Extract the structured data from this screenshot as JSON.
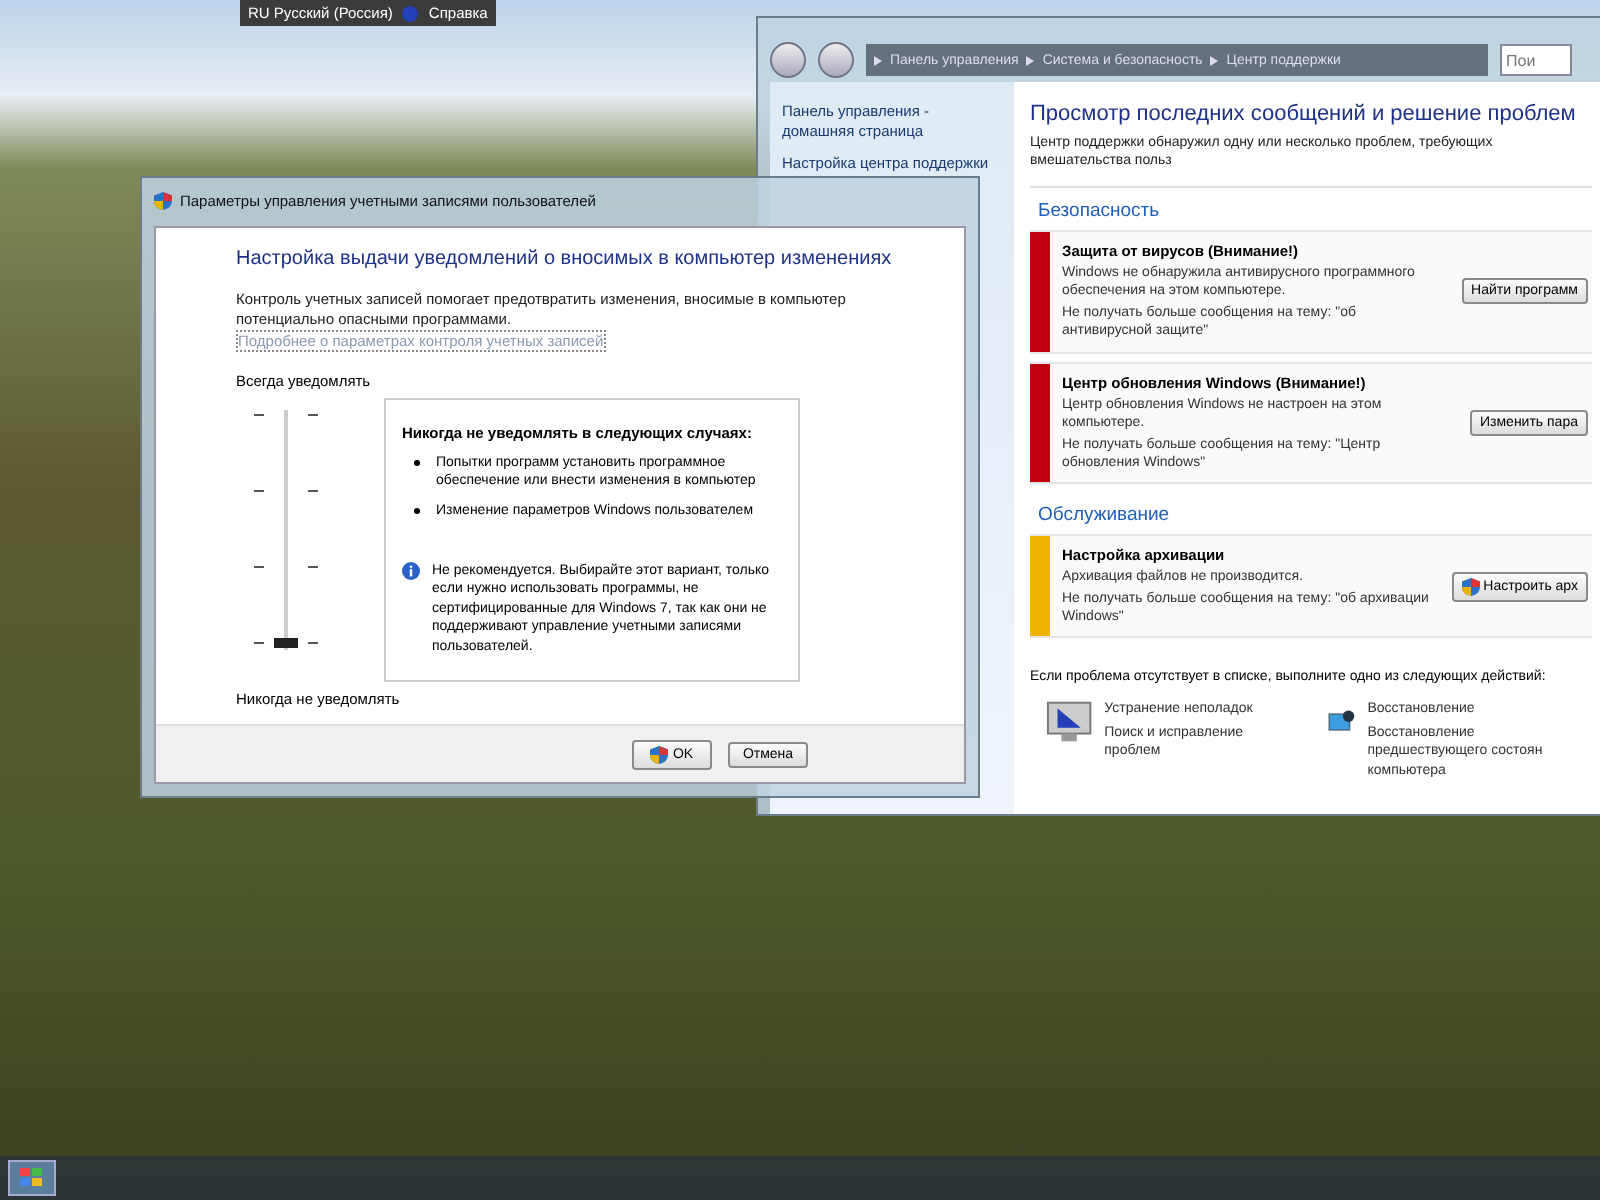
{
  "language_bar": {
    "language": "RU Русский (Россия)",
    "help": "Справка"
  },
  "control_panel": {
    "breadcrumb": [
      "Панель управления",
      "Система и безопасность",
      "Центр поддержки"
    ],
    "search": {
      "placeholder": "Пои"
    },
    "sidebar_links": [
      "Панель управления - домашняя страница",
      "Настройка центра поддержки"
    ],
    "title": "Просмотр последних сообщений и решение проблем",
    "subtitle": "Центр поддержки обнаружил одну или несколько проблем, требующих вмешательства польз",
    "sections": [
      {
        "heading": "Безопасность",
        "items": [
          {
            "title": "Защита от вирусов  (Внимание!)",
            "description": "Windows не обнаружила антивирусного программного обеспечения на этом компьютере.",
            "dismiss": "Не получать больше сообщения на тему: \"об антивирусной защите\"",
            "button": "Найти программ",
            "shield": false,
            "color": "#c00010"
          },
          {
            "title": "Центр обновления Windows  (Внимание!)",
            "description": "Центр обновления Windows не настроен на этом компьютере.",
            "dismiss": "Не получать больше сообщения на тему: \"Центр обновления Windows\"",
            "button": "Изменить пара",
            "shield": false,
            "color": "#c00010"
          }
        ]
      },
      {
        "heading": "Обслуживание",
        "items": [
          {
            "title": "Настройка архивации",
            "description": "Архивация файлов не производится.",
            "dismiss": "Не получать больше сообщения на тему: \"об архивации Windows\"",
            "button": "Настроить арх",
            "shield": true,
            "color": "#f0b400"
          }
        ]
      }
    ],
    "footer_prompt": "Если проблема отсутствует в списке, выполните одно из следующих действий:",
    "actions": [
      {
        "kind": "troubleshoot",
        "title": "Устранение неполадок",
        "description": "Поиск и исправление проблем"
      },
      {
        "kind": "recovery",
        "title": "Восстановление",
        "description": "Восстановление предшествующего состоян компьютера"
      }
    ]
  },
  "uac_dialog": {
    "title": "Параметры управления учетными записями пользователей",
    "heading": "Настройка выдачи уведомлений о вносимых в компьютер изменениях",
    "description": "Контроль учетных записей помогает предотвратить изменения, вносимые в компьютер потенциально опасными программами.",
    "link": "Подробнее о параметрах контроля учетных записей",
    "slider": {
      "top_label": "Всегда уведомлять",
      "bottom_label": "Никогда не уведомлять",
      "level": 0
    },
    "info": {
      "heading": "Никогда не уведомлять в следующих случаях:",
      "bullets": [
        "Попытки программ установить программное обеспечение или внести изменения в компьютер",
        "Изменение параметров Windows пользователем"
      ],
      "note": "Не рекомендуется. Выбирайте этот вариант, только если нужно использовать программы, не сертифицированные для Windows 7, так как они не поддерживают управление учетными записями пользователей."
    },
    "buttons": [
      {
        "label": "OK",
        "shield": true
      },
      {
        "label": "Отмена",
        "shield": false
      }
    ]
  }
}
